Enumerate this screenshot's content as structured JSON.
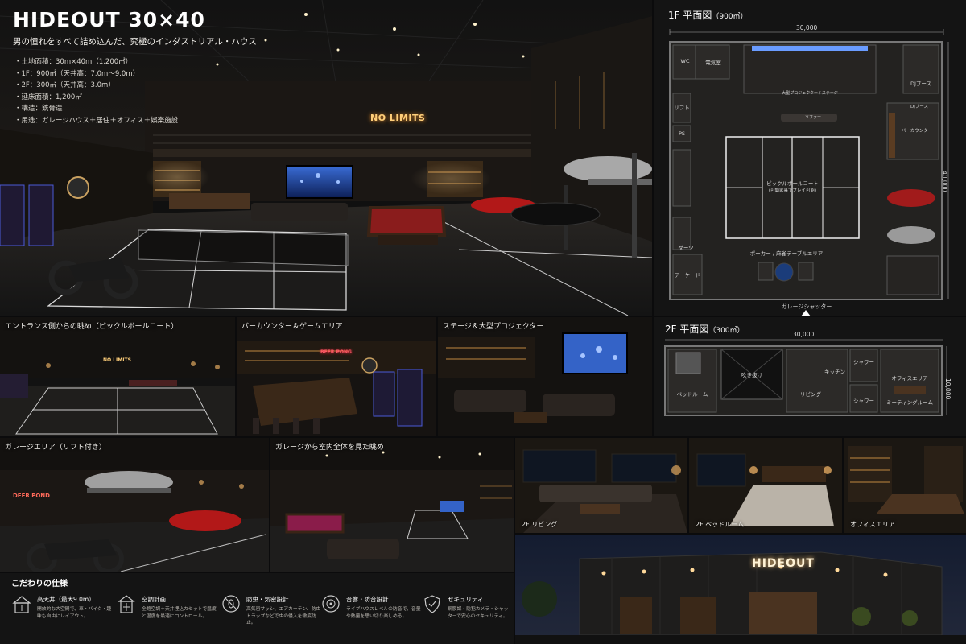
{
  "hero": {
    "title": "HIDEOUT 30×40",
    "subtitle": "男の憧れをすべて詰め込んだ、究極のインダストリアル・ハウス",
    "specs": [
      "・土地面積：30m×40m（1,200㎡）",
      "・1F：900㎡（天井高：7.0m〜9.0m）",
      "・2F：300㎡（天井高：3.0m）",
      "・延床面積：1,200㎡",
      "・構造：鉄骨造",
      "・用途：ガレージハウス＋居住＋オフィス＋娯楽施設"
    ],
    "neon_sign": "NO LIMITS"
  },
  "floor1": {
    "title": "1F 平面図",
    "area": "（900㎡）",
    "width_label": "30,000",
    "depth_label": "40,000",
    "rooms": {
      "wc": "WC",
      "electrical": "電気室",
      "stage": "大型プロジェクター / ステージ",
      "dj_booth": "DJブース",
      "lift": "リフト",
      "ps": "PS",
      "sofa": "ソファー",
      "bar_counter": "バーカウンター",
      "court": "ピックルボールコート",
      "court_note": "(可動家具でプレイ可能)",
      "darts": "ダーツ",
      "arcade": "アーケード",
      "poker": "ポーカー / 麻雀テーブルエリア"
    },
    "shutter": "ガレージシャッター",
    "dj_label_2": "DJブース"
  },
  "floor2": {
    "title": "2F 平面図",
    "area": "（300㎡）",
    "width_label": "30,000",
    "depth_label": "10,000",
    "rooms": {
      "bedroom": "ベッドルーム",
      "void": "吹き抜け",
      "kitchen": "キッチン",
      "living": "リビング",
      "shower1": "シャワー",
      "shower2": "シャワー",
      "office": "オフィスエリア",
      "meeting": "ミーティングルーム"
    }
  },
  "photos": {
    "entrance": "エントランス側からの眺め（ピックルボールコート）",
    "bar": "バーカウンター＆ゲームエリア",
    "stage": "ステージ＆大型プロジェクター",
    "garage": "ガレージエリア（リフト付き）",
    "overview": "ガレージから室内全体を見た眺め",
    "living2f": "2F リビング",
    "bedroom2f": "2F ベッドルーム",
    "office": "オフィスエリア",
    "exterior_sign": "HIDEOUT",
    "beer_pong": "BEER PONG",
    "beer_pong_2": "DEER POND"
  },
  "features": {
    "title": "こだわりの仕様",
    "items": [
      {
        "title": "高天井（最大9.0m）",
        "desc": "開放的な大空間で、車・バイク・趣味も自由にレイアウト。",
        "icon": "ceiling-icon"
      },
      {
        "title": "空調計画",
        "desc": "全館空調＋天井埋込カセットで温度と湿度を最適にコントロール。",
        "icon": "hvac-icon"
      },
      {
        "title": "防虫・気密設計",
        "desc": "高気密サッシ、エアカーテン、防虫トラップなどで虫の侵入を徹底防止。",
        "icon": "no-bug-icon"
      },
      {
        "title": "音響・防音設計",
        "desc": "ライブハウスレベルの防音で、音量や熱量を思い切り楽しめる。",
        "icon": "speaker-icon"
      },
      {
        "title": "セキュリティ",
        "desc": "網膜認・防犯カメラ・シャッターで安心のセキュリティ。",
        "icon": "shield-icon"
      }
    ]
  }
}
